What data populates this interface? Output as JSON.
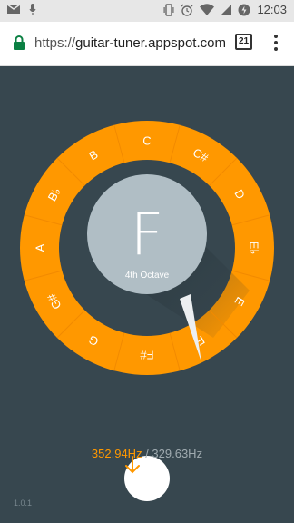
{
  "status_bar": {
    "time": "12:03",
    "icons": [
      "mail-icon",
      "mic-icon",
      "vibrate-icon",
      "alarm-icon",
      "wifi-icon",
      "signal-icon",
      "battery-charging-icon"
    ]
  },
  "browser": {
    "url_scheme": "https://",
    "url_host": "guitar-tuner.appspot.com",
    "tab_count": "21"
  },
  "tuner": {
    "detected_note": "F",
    "octave_label": "4th Octave",
    "notes": [
      "C",
      "C#",
      "D",
      "E♭",
      "E",
      "F",
      "F#",
      "G",
      "G#",
      "A",
      "B♭",
      "B"
    ],
    "current_frequency": "352.94Hz",
    "separator": " / ",
    "target_frequency": "329.63Hz"
  },
  "colors": {
    "background": "#37474f",
    "ring": "#ff9800",
    "center_disc": "#b0bec5",
    "needle": "#eceff1"
  },
  "version": "1.0.1"
}
